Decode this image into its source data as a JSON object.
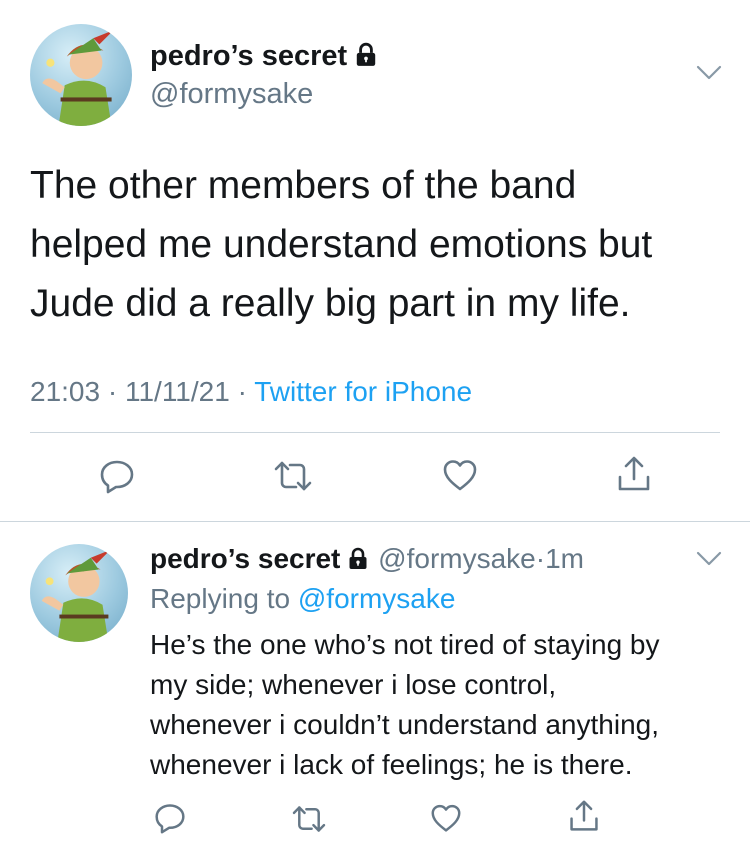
{
  "main_tweet": {
    "display_name": "pedro’s secret",
    "handle": "@formysake",
    "text_lines": [
      "The other members of the band",
      "helped me understand emotions but",
      "Jude did a really big part in my life."
    ],
    "time": "21:03",
    "date": "11/11/21",
    "source": "Twitter for iPhone",
    "separator": "·"
  },
  "reply_tweet": {
    "display_name": "pedro’s secret",
    "handle": "@formysake",
    "separator": "·",
    "age": "1m",
    "replying_prefix": "Replying to",
    "replying_handle": "@formysake",
    "text_lines": [
      "He’s the one who’s not tired of staying by",
      "my side; whenever i lose control,",
      "whenever i couldn’t understand anything,",
      "whenever i lack of feelings; he is there."
    ]
  },
  "icons": {
    "lock": "lock-icon",
    "chevron": "chevron-down-icon",
    "reply": "reply-icon",
    "retweet": "retweet-icon",
    "like": "heart-icon",
    "share": "share-icon"
  },
  "colors": {
    "text": "#14171a",
    "secondary": "#657786",
    "link": "#1da1f2",
    "divider": "#ccd6dd"
  }
}
